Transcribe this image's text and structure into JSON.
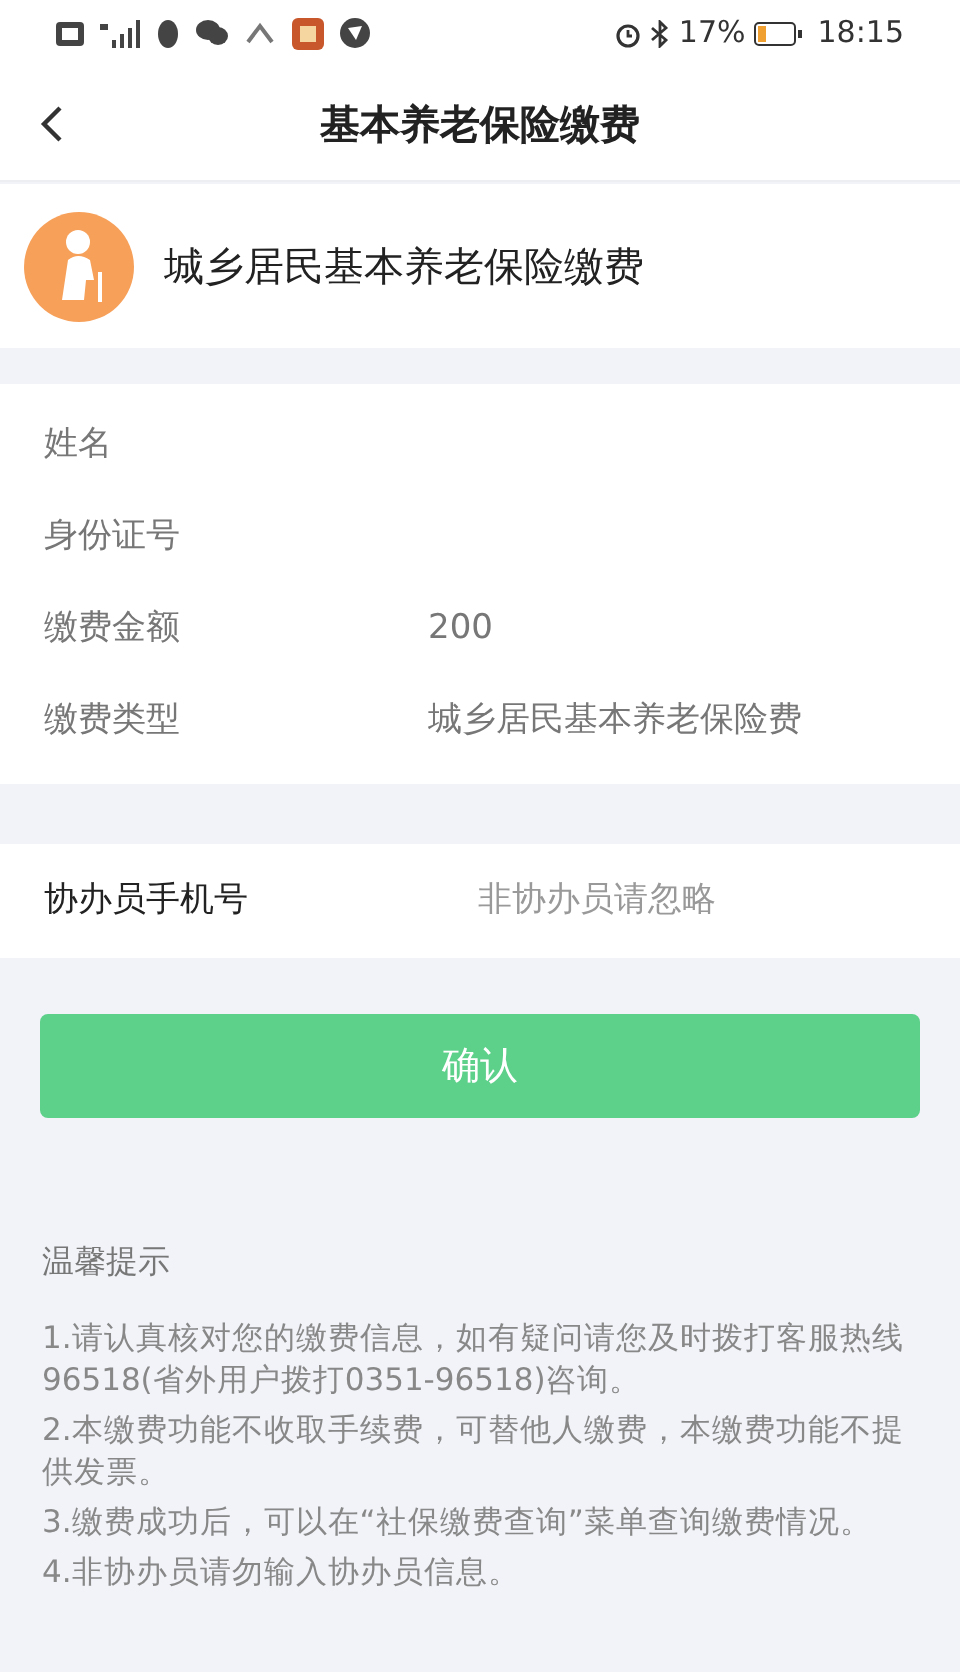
{
  "status_bar": {
    "battery": "17%",
    "time": "18:15"
  },
  "header": {
    "title": "基本养老保险缴费"
  },
  "service": {
    "title": "城乡居民基本养老保险缴费"
  },
  "fields": [
    {
      "label": "姓名"
    },
    {
      "label": "身份证号"
    },
    {
      "label": "缴费金额",
      "value": "200"
    },
    {
      "label": "缴费类型",
      "value": "城乡居民基本养老保险费"
    }
  ],
  "assistant_phone": {
    "label": "协办员手机号",
    "placeholder": "非协办员请忽略"
  },
  "confirm_button": "确认",
  "tips": {
    "title": "温馨提示",
    "items": [
      "1.请认真核对您的缴费信息，如有疑问请您及时拨打客服热线96518(省外用户拨打0351-96518)咨询。",
      "2.本缴费功能不收取手续费，可替他人缴费，本缴费功能不提供发票。",
      "3.缴费成功后，可以在“社保缴费查询”菜单查询缴费情况。",
      "4.非协办员请勿输入协办员信息。"
    ]
  }
}
